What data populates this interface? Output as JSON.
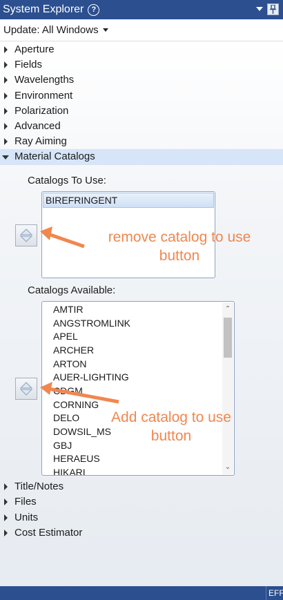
{
  "window": {
    "title": "System Explorer",
    "help_icon_glyph": "?",
    "help_icon": "question-circle-icon",
    "dropdown_icon": "triangle-down-icon",
    "pin_icon": "pin-icon"
  },
  "update": {
    "label": "Update: All Windows"
  },
  "tree_top": [
    {
      "label": "Aperture"
    },
    {
      "label": "Fields"
    },
    {
      "label": "Wavelengths"
    },
    {
      "label": "Environment"
    },
    {
      "label": "Polarization"
    },
    {
      "label": "Advanced"
    },
    {
      "label": "Ray Aiming"
    }
  ],
  "material_catalogs": {
    "label": "Material Catalogs",
    "catalogs_to_use_label": "Catalogs To Use:",
    "catalogs_to_use": [
      "BIREFRINGENT"
    ],
    "catalogs_available_label": "Catalogs Available:",
    "catalogs_available": [
      "AMTIR",
      "ANGSTROMLINK",
      "APEL",
      "ARCHER",
      "ARTON",
      "AUER-LIGHTING",
      "CDGM",
      "CORNING",
      "DELO",
      "DOWSIL_MS",
      "GBJ",
      "HERAEUS",
      "HIKARI"
    ]
  },
  "tree_bottom": [
    {
      "label": "Title/Notes"
    },
    {
      "label": "Files"
    },
    {
      "label": "Units"
    },
    {
      "label": "Cost Estimator"
    }
  ],
  "annotations": {
    "remove_line1": "remove catalog to use",
    "remove_line2": "button",
    "add_line1": "Add catalog to use",
    "add_line2": "button",
    "color": "#f0874f"
  },
  "statusbar": {
    "tab": "EFF"
  },
  "colors": {
    "accent": "#2b4f8f",
    "selection": "#d6e5f7"
  }
}
